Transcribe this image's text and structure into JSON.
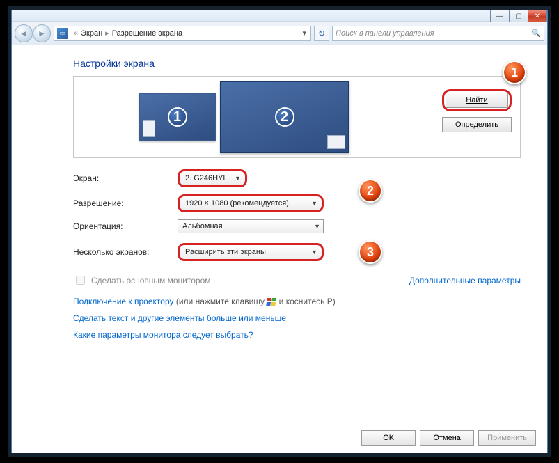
{
  "breadcrumb": {
    "root": "Экран",
    "current": "Разрешение экрана"
  },
  "search": {
    "placeholder": "Поиск в панели управления"
  },
  "title": "Настройки экрана",
  "buttons": {
    "detect": "Найти",
    "identify": "Определить",
    "ok": "OK",
    "cancel": "Отмена",
    "apply": "Применить"
  },
  "monitors": {
    "m1": "1",
    "m2": "2"
  },
  "labels": {
    "screen": "Экран:",
    "resolution": "Разрешение:",
    "orientation": "Ориентация:",
    "multiple": "Несколько экранов:",
    "make_primary": "Сделать основным монитором",
    "advanced": "Дополнительные параметры"
  },
  "values": {
    "screen": "2. G246HYL",
    "resolution": "1920 × 1080 (рекомендуется)",
    "orientation": "Альбомная",
    "multiple": "Расширить эти экраны"
  },
  "links": {
    "projector": "Подключение к проектору",
    "projector_hint_a": " (или нажмите клавишу ",
    "projector_hint_b": " и коснитесь P)",
    "textsize": "Сделать текст и другие элементы больше или меньше",
    "which": "Какие параметры монитора следует выбрать?"
  },
  "steps": {
    "s1": "1",
    "s2": "2",
    "s3": "3"
  }
}
